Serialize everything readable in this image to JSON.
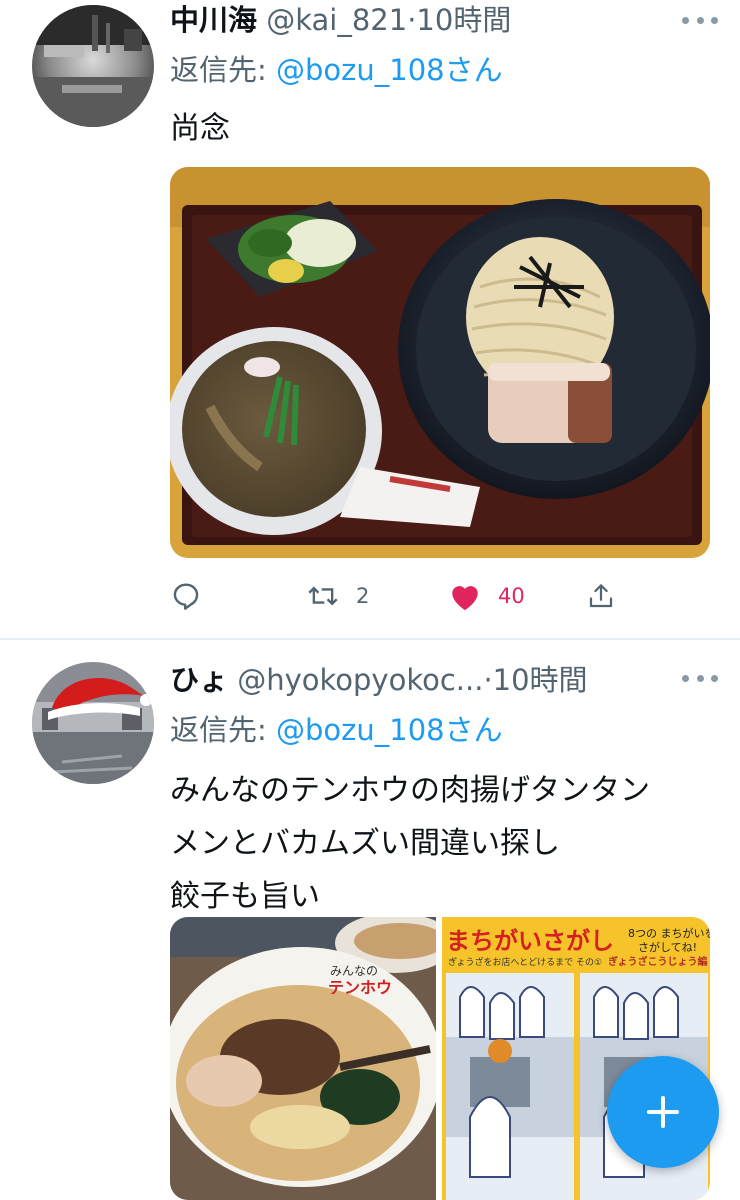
{
  "colors": {
    "accent": "#1d9bf0",
    "like": "#e0245e",
    "secondary_text": "#536471",
    "primary_text": "#0f1419"
  },
  "tweets": [
    {
      "name": "中川海",
      "handle": "@kai_821",
      "separator": "·",
      "time": "10時間",
      "reply_prefix": "返信先: ",
      "reply_to": "@bozu_108さん",
      "text_lines": [
        "尚念"
      ],
      "media_description_icon": "tsukemen-photo",
      "reply_count": "",
      "retweet_count": "2",
      "like_count": "40",
      "liked": true
    },
    {
      "name": "ひょ",
      "handle": "@hyokopyokoc...",
      "separator": "·",
      "time": "10時間",
      "reply_prefix": "返信先: ",
      "reply_to": "@bozu_108さん",
      "text_lines": [
        "みんなのテンホウの肉揚げタンタン",
        "メンとバカムズい間違い探し",
        "餃子も旨い"
      ],
      "media_panel_right": {
        "title": "まちがいさがし",
        "subtitle": "ぎょうざをお店へとどけるまで その①",
        "note_line1": "8つの まちがいを",
        "note_line2": "さがしてね!",
        "series": "ぎょうざこうじょう編"
      },
      "media_panel_left": {
        "bowl_brand_line1": "みんなの",
        "bowl_brand_line2": "テンホウ"
      }
    }
  ],
  "compose_button_icon": "plus-icon"
}
